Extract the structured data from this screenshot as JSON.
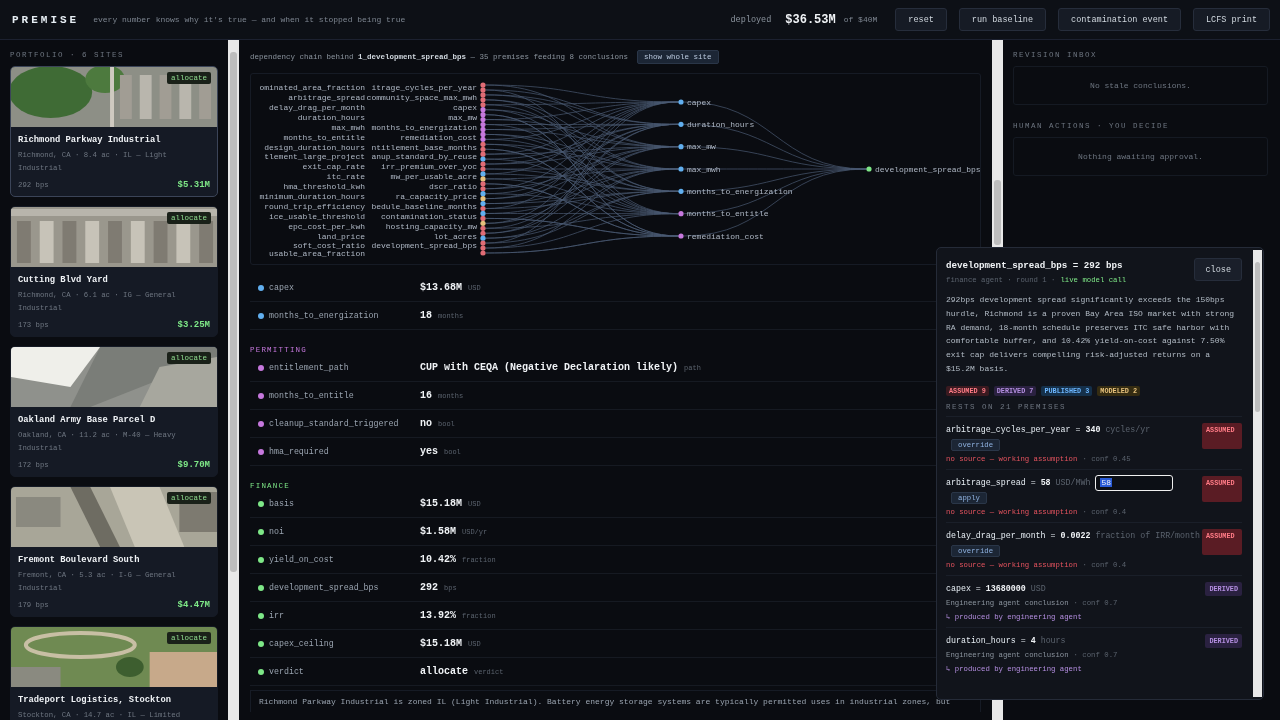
{
  "topbar": {
    "brand": "PREMISE",
    "tagline": "every number knows why it's true — and when it stopped being true",
    "deployed_label": "deployed",
    "deployed_amount": "$36.53M",
    "deployed_of": "of $40M",
    "buttons": [
      "reset",
      "run baseline",
      "contamination event",
      "LCFS print"
    ]
  },
  "portfolio": {
    "heading": "PORTFOLIO · 6 SITES",
    "sites": [
      {
        "name": "Richmond Parkway Industrial",
        "location": "Richmond, CA · 8.4 ac · IL — Light Industrial",
        "spread": "292 bps",
        "amount": "$5.31M",
        "badge": "allocate",
        "selected": true
      },
      {
        "name": "Cutting Blvd Yard",
        "location": "Richmond, CA · 6.1 ac · IG — General Industrial",
        "spread": "173 bps",
        "amount": "$3.25M",
        "badge": "allocate",
        "selected": false
      },
      {
        "name": "Oakland Army Base Parcel D",
        "location": "Oakland, CA · 11.2 ac · M-40 — Heavy Industrial",
        "spread": "172 bps",
        "amount": "$9.70M",
        "badge": "allocate",
        "selected": false
      },
      {
        "name": "Fremont Boulevard South",
        "location": "Fremont, CA · 5.3 ac · I-G — General Industrial",
        "spread": "179 bps",
        "amount": "$4.47M",
        "badge": "allocate",
        "selected": false
      },
      {
        "name": "Tradeport Logistics, Stockton",
        "location": "Stockton, CA · 14.7 ac · IL — Limited",
        "badge": "allocate",
        "selected": false
      }
    ]
  },
  "graph": {
    "header": "dependency chain behind **1_development_spread_bps** — 35 premises feeding 8 conclusions",
    "button": "show whole site",
    "premises": [
      {
        "label": "ominated_area_fraction",
        "color": "#e06c75"
      },
      {
        "label": "itrage_cycles_per_year",
        "color": "#e06c75"
      },
      {
        "label": "arbitrage_spread",
        "color": "#e06c75"
      },
      {
        "label": "community_space_max_mwh",
        "color": "#e06c75"
      },
      {
        "label": "delay_drag_per_month",
        "color": "#e06c75"
      },
      {
        "label": "capex",
        "color": "#c678dd"
      },
      {
        "label": "duration_hours",
        "color": "#c678dd"
      },
      {
        "label": "max_mw",
        "color": "#c678dd"
      },
      {
        "label": "max_mwh",
        "color": "#c678dd"
      },
      {
        "label": "months_to_energization",
        "color": "#c678dd"
      },
      {
        "label": "months_to_entitle",
        "color": "#c678dd"
      },
      {
        "label": "remediation_cost",
        "color": "#c678dd"
      },
      {
        "label": "design_duration_hours",
        "color": "#e06c75"
      },
      {
        "label": "ntitlement_base_months",
        "color": "#e06c75"
      },
      {
        "label": "tlement_large_project",
        "color": "#e06c75"
      },
      {
        "label": "anup_standard_by_reuse",
        "color": "#61afef"
      },
      {
        "label": "exit_cap_rate",
        "color": "#e06c75"
      },
      {
        "label": "irr_premium_over_yoc",
        "color": "#e06c75"
      },
      {
        "label": "itc_rate",
        "color": "#61afef"
      },
      {
        "label": "mw_per_usable_acre",
        "color": "#e5c07b"
      },
      {
        "label": "hma_threshold_kwh",
        "color": "#e06c75"
      },
      {
        "label": "dscr_ratio",
        "color": "#e06c75"
      },
      {
        "label": "minimum_duration_hours",
        "color": "#61afef"
      },
      {
        "label": "ra_capacity_price",
        "color": "#e5c07b"
      },
      {
        "label": "round_trip_efficiency",
        "color": "#61afef"
      },
      {
        "label": "bedule_baseline_months",
        "color": "#e06c75"
      },
      {
        "label": "ice_usable_threshold",
        "color": "#61afef"
      },
      {
        "label": "contamination_status",
        "color": "#e06c75"
      },
      {
        "label": "epc_cost_per_kwh",
        "color": "#e5c07b"
      },
      {
        "label": "hosting_capacity_mw",
        "color": "#e06c75"
      },
      {
        "label": "land_price",
        "color": "#e06c75"
      },
      {
        "label": "lot_acres",
        "color": "#61afef"
      },
      {
        "label": "soft_cost_ratio",
        "color": "#e06c75"
      },
      {
        "label": "development_spread_bps",
        "color": "#e06c75"
      },
      {
        "label": "usable_area_fraction",
        "color": "#e06c75"
      }
    ],
    "conclusions": [
      {
        "label": "capex",
        "color": "#61afef"
      },
      {
        "label": "duration_hours",
        "color": "#61afef"
      },
      {
        "label": "max_mw",
        "color": "#61afef"
      },
      {
        "label": "max_mwh",
        "color": "#61afef"
      },
      {
        "label": "months_to_energization",
        "color": "#61afef"
      },
      {
        "label": "months_to_entitle",
        "color": "#c678dd"
      },
      {
        "label": "remediation_cost",
        "color": "#c678dd"
      }
    ],
    "target": {
      "label": "development_spread_bps",
      "color": "#7ee787"
    }
  },
  "sections": [
    {
      "color": "#61afef",
      "rows": [
        {
          "name": "capex",
          "value": "$13.68M",
          "unit": "USD"
        },
        {
          "name": "months_to_energization",
          "value": "18",
          "unit": "months"
        }
      ]
    },
    {
      "title": "PERMITTING",
      "color": "#c678dd",
      "rows": [
        {
          "name": "entitlement_path",
          "value": "CUP with CEQA (Negative Declaration likely)",
          "unit": "path"
        },
        {
          "name": "months_to_entitle",
          "value": "16",
          "unit": "months"
        },
        {
          "name": "cleanup_standard_triggered",
          "value": "no",
          "unit": "bool"
        },
        {
          "name": "hma_required",
          "value": "yes",
          "unit": "bool"
        }
      ]
    },
    {
      "title": "FINANCE",
      "color": "#7ee787",
      "rows": [
        {
          "name": "basis",
          "value": "$15.18M",
          "unit": "USD"
        },
        {
          "name": "noi",
          "value": "$1.58M",
          "unit": "USD/yr"
        },
        {
          "name": "yield_on_cost",
          "value": "10.42%",
          "unit": "fraction"
        },
        {
          "name": "development_spread_bps",
          "value": "292",
          "unit": "bps"
        },
        {
          "name": "irr",
          "value": "13.92%",
          "unit": "fraction"
        },
        {
          "name": "capex_ceiling",
          "value": "$15.18M",
          "unit": "USD"
        },
        {
          "name": "verdict",
          "value": "allocate",
          "unit": "verdict"
        }
      ]
    }
  ],
  "summary": "Richmond Parkway Industrial is zoned IL (Light Industrial). Battery energy storage systems are typically permitted uses in industrial zones, but",
  "inbox": [
    {
      "heading": "REVISION INBOX",
      "empty": "No stale conclusions."
    },
    {
      "heading": "HUMAN ACTIONS · YOU DECIDE",
      "empty": "Nothing awaiting approval."
    }
  ],
  "popover": {
    "title": "development_spread_bps = 292 bps",
    "close": "close",
    "meta": "finance agent · round 1 ·",
    "live": "live model call",
    "rationale": "292bps development spread significantly exceeds the 150bps hurdle, Richmond is a proven Bay Area ISO market with strong RA demand, 18-month schedule preserves ITC safe harbor with comfortable buffer, and 10.42% yield-on-cost against 7.50% exit cap delivers compelling risk-adjusted returns on a $15.2M basis.",
    "counts": [
      {
        "kind": "assumed",
        "label": "ASSUMED 9"
      },
      {
        "kind": "derived",
        "label": "DERIVED 7"
      },
      {
        "kind": "published",
        "label": "PUBLISHED 3"
      },
      {
        "kind": "modeled",
        "label": "MODELED 2"
      }
    ],
    "premises_heading": "RESTS ON 21 PREMISES",
    "premises": [
      {
        "kind": "assumed",
        "name": "arbitrage_cycles_per_year =",
        "value": "340",
        "unit": "cycles/yr",
        "tag": "ASSUMED",
        "action": "override",
        "source": "no source — working assumption",
        "conf": "· conf 0.45"
      },
      {
        "kind": "assumed",
        "name": "arbitrage_spread =",
        "value": "58",
        "unit": "USD/MWh",
        "tag": "ASSUMED",
        "action": "apply",
        "input": "58",
        "text_selected": true,
        "source": "no source — working assumption",
        "conf": "· conf 0.4"
      },
      {
        "kind": "assumed",
        "name": "delay_drag_per_month =",
        "value": "0.0022",
        "unit": "fraction of IRR/month",
        "tag": "ASSUMED",
        "action": "override",
        "source": "no source — working assumption",
        "conf": "· conf 0.4"
      },
      {
        "kind": "derived",
        "name": "capex =",
        "value": "13680000",
        "unit": "USD",
        "tag": "DERIVED",
        "source": "Engineering agent conclusion",
        "conf": "· conf 0.7",
        "produced_by": "↳ produced by engineering agent"
      },
      {
        "kind": "derived",
        "name": "duration_hours =",
        "value": "4",
        "unit": "hours",
        "tag": "DERIVED",
        "source": "Engineering agent conclusion",
        "conf": "· conf 0.7",
        "produced_by": "↳ produced by engineering agent"
      }
    ]
  }
}
